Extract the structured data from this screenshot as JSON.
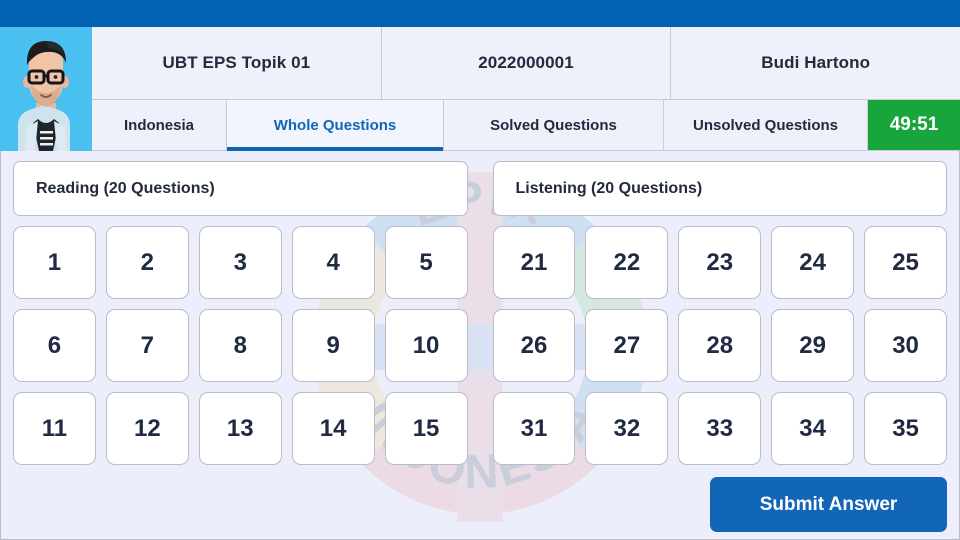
{
  "header": {
    "avatar_alt": "user-avatar",
    "exam_title": "UBT EPS Topik 01",
    "registration_number": "2022000001",
    "candidate_name": "Budi Hartono"
  },
  "tabs": [
    {
      "label": "Indonesia",
      "active": false
    },
    {
      "label": "Whole Questions",
      "active": true
    },
    {
      "label": "Solved Questions",
      "active": false
    },
    {
      "label": "Unsolved Questions",
      "active": false
    }
  ],
  "timer": {
    "value": "49:51",
    "color": "#17a53c"
  },
  "sections": [
    {
      "title": "Reading (20 Questions)",
      "questions": [
        "1",
        "2",
        "3",
        "4",
        "5",
        "6",
        "7",
        "8",
        "9",
        "10",
        "11",
        "12",
        "13",
        "14",
        "15"
      ]
    },
    {
      "title": "Listening (20 Questions)",
      "questions": [
        "21",
        "22",
        "23",
        "24",
        "25",
        "26",
        "27",
        "28",
        "29",
        "30",
        "31",
        "32",
        "33",
        "34",
        "35"
      ]
    }
  ],
  "actions": {
    "submit_label": "Submit Answer"
  },
  "watermark": {
    "text": "EPIK INDONESIA"
  },
  "colors": {
    "topbar": "#0062b0",
    "accent": "#1266b8",
    "timer_green": "#17a53c",
    "page_background": "#eceffb"
  }
}
